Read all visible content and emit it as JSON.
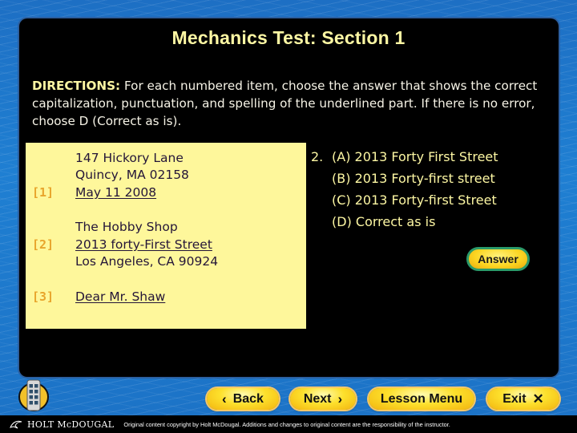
{
  "header": {
    "title": "Mechanics Test: Section 1"
  },
  "directions": {
    "lead": "DIRECTIONS:",
    "text": " For each numbered item, choose the answer that shows the correct capitalization, punctuation, and spelling of the underlined part. If there is no error, choose D (Correct as is)."
  },
  "letter": {
    "items": [
      {
        "num": "[1]",
        "lines": [
          "147 Hickory Lane",
          "Quincy, MA 02158",
          "May 11 2008"
        ],
        "underlined_index": 2
      },
      {
        "num": "[2]",
        "lines": [
          "The Hobby Shop",
          "2013 forty-First Street",
          "Los Angeles, CA 90924"
        ],
        "underlined_index": 1
      },
      {
        "num": "[3]",
        "lines": [
          "Dear Mr. Shaw"
        ],
        "underlined_index": 0
      }
    ]
  },
  "question": {
    "number": "2.",
    "options": [
      {
        "letter": "(A)",
        "text": "2013 Forty First Street"
      },
      {
        "letter": "(B)",
        "text": "2013 Forty-first street"
      },
      {
        "letter": "(C)",
        "text": "2013 Forty-first Street"
      },
      {
        "letter": "(D)",
        "text": "Correct as is"
      }
    ],
    "answer_label": "Answer"
  },
  "nav": {
    "remote_icon": "remote-control-icon",
    "back": {
      "label": "Back",
      "icon": "chevron-left-icon"
    },
    "next": {
      "label": "Next",
      "icon": "chevron-right-icon"
    },
    "lesson_menu": {
      "label": "Lesson Menu"
    },
    "exit": {
      "label": "Exit",
      "icon": "close-icon"
    }
  },
  "footer": {
    "brand": "HOLT McDOUGAL",
    "copyright": "Original content copyright by Holt McDougal.  Additions and changes to original content are the responsibility of the instructor."
  },
  "colors": {
    "title": "#fdf7a3",
    "panel": "#000000",
    "letter_bg": "#fef79b",
    "item_number": "#e8a52c",
    "letter_text": "#241538",
    "button_yellow": "#fde02c",
    "answer_border": "#2a9a6a",
    "background_blue": "#1f7fd2"
  }
}
